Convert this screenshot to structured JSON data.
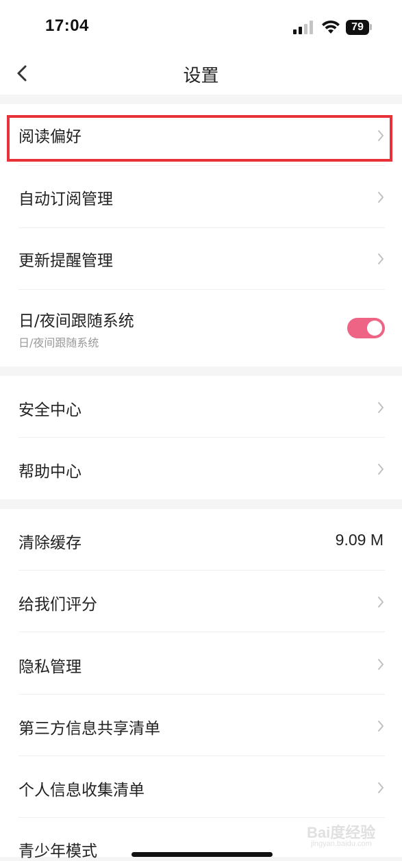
{
  "status": {
    "time": "17:04",
    "battery": "79"
  },
  "nav": {
    "title": "设置"
  },
  "groups": [
    {
      "items": [
        {
          "label": "阅读偏好"
        },
        {
          "label": "自动订阅管理"
        },
        {
          "label": "更新提醒管理"
        },
        {
          "label": "日/夜间跟随系统",
          "sublabel": "日/夜间跟随系统",
          "toggle_on": true
        }
      ]
    },
    {
      "items": [
        {
          "label": "安全中心"
        },
        {
          "label": "帮助中心"
        }
      ]
    },
    {
      "items": [
        {
          "label": "清除缓存",
          "value": "9.09 M"
        },
        {
          "label": "给我们评分"
        },
        {
          "label": "隐私管理"
        },
        {
          "label": "第三方信息共享清单"
        },
        {
          "label": "个人信息收集清单"
        },
        {
          "label": "青少年模式"
        }
      ]
    }
  ],
  "watermark": {
    "main": "Bai度经验",
    "sub": "jingyan.baidu.com"
  },
  "colors": {
    "accent": "#ee6485",
    "highlight": "#e8323a"
  }
}
